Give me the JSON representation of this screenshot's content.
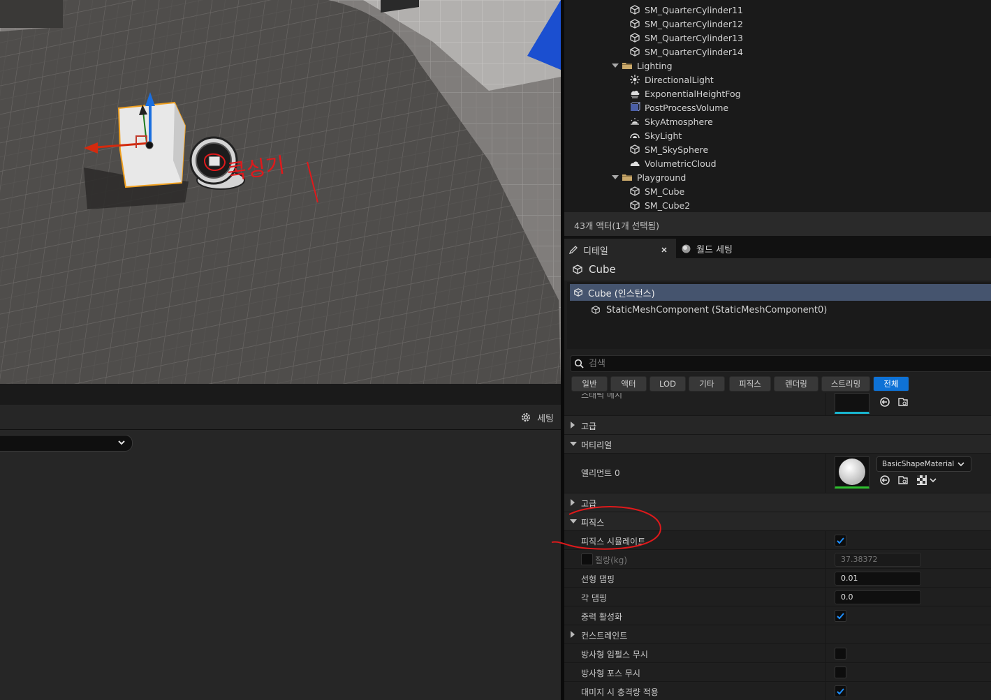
{
  "viewport": {
    "annotation_text": "콕싱기"
  },
  "bottom_panel": {
    "settings_label": "세팅"
  },
  "outliner": {
    "items": [
      {
        "label": "SM_QuarterCylinder11",
        "icon": "static-mesh-icon",
        "indent": 2
      },
      {
        "label": "SM_QuarterCylinder12",
        "icon": "static-mesh-icon",
        "indent": 2
      },
      {
        "label": "SM_QuarterCylinder13",
        "icon": "static-mesh-icon",
        "indent": 2
      },
      {
        "label": "SM_QuarterCylinder14",
        "icon": "static-mesh-icon",
        "indent": 2
      },
      {
        "label": "Lighting",
        "icon": "folder-icon",
        "indent": 1
      },
      {
        "label": "DirectionalLight",
        "icon": "directional-light-icon",
        "indent": 2
      },
      {
        "label": "ExponentialHeightFog",
        "icon": "fog-icon",
        "indent": 2
      },
      {
        "label": "PostProcessVolume",
        "icon": "post-process-icon",
        "indent": 2
      },
      {
        "label": "SkyAtmosphere",
        "icon": "sky-atmosphere-icon",
        "indent": 2
      },
      {
        "label": "SkyLight",
        "icon": "sky-light-icon",
        "indent": 2
      },
      {
        "label": "SM_SkySphere",
        "icon": "static-mesh-icon",
        "indent": 2
      },
      {
        "label": "VolumetricCloud",
        "icon": "cloud-icon",
        "indent": 2
      },
      {
        "label": "Playground",
        "icon": "folder-icon",
        "indent": 1
      },
      {
        "label": "SM_Cube",
        "icon": "static-mesh-icon",
        "indent": 2
      },
      {
        "label": "SM_Cube2",
        "icon": "static-mesh-icon",
        "indent": 2
      }
    ],
    "footer": "43개 액터(1개 선택됨)"
  },
  "tabs": {
    "details": "디테일",
    "world_settings": "월드 세팅"
  },
  "details": {
    "actor_name": "Cube",
    "component_root": "Cube (인스턴스)",
    "component_child": "StaticMeshComponent (StaticMeshComponent0)",
    "search_placeholder": "검색",
    "filters": [
      "일반",
      "액터",
      "LOD",
      "기타",
      "피직스",
      "렌더링",
      "스트리밍",
      "전체"
    ],
    "active_filter": "전체",
    "partial_row_label": "스태틱 메시",
    "advanced_1": "고급",
    "material_category": "머티리얼",
    "element0_label": "엘리먼트 0",
    "material_value": "BasicShapeMaterial",
    "advanced_2": "고급",
    "physics_category": "피직스",
    "simulate_physics": "피직스 시뮬레이트",
    "mass_label": "질량(kg)",
    "mass_value": "37.38372",
    "linear_damping_label": "선형 댐핑",
    "linear_damping_value": "0.01",
    "angular_damping_label": "각 댐핑",
    "angular_damping_value": "0.0",
    "enable_gravity_label": "중력 활성화",
    "constraints_label": "컨스트레인트",
    "ignore_radial_impulse": "방사형 임펄스 무시",
    "ignore_radial_force": "방사형 포스 무시",
    "apply_impulse_on_damage": "대미지 시 충격량 적용"
  },
  "colors": {
    "accent": "#0e72d6",
    "selection": "#45546e",
    "annotation": "#e0191b",
    "gizmo_x": "#d32a0e",
    "gizmo_y": "#1c7a1c",
    "gizmo_z": "#1a6fe0",
    "selection_outline": "#f0a020"
  }
}
